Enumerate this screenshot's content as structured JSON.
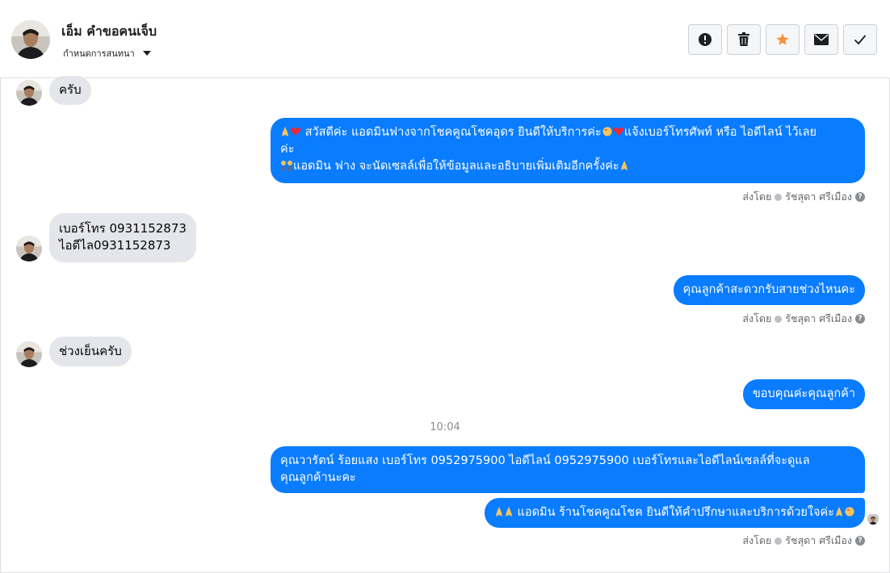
{
  "header": {
    "contact_name": "เอ็ม คำขอคนเจ็บ",
    "subtitle": "กำหนดการสนทนา",
    "actions": [
      {
        "name": "alert-button",
        "icon": "exclamation-circle-icon"
      },
      {
        "name": "delete-button",
        "icon": "trash-icon"
      },
      {
        "name": "star-button",
        "icon": "star-icon"
      },
      {
        "name": "mail-button",
        "icon": "envelope-icon"
      },
      {
        "name": "done-button",
        "icon": "check-icon"
      }
    ]
  },
  "messages": [
    {
      "from": "customer",
      "text": "ครับ"
    },
    {
      "from": "page",
      "line1": " สวัสดีค่ะ แอดมินฟางจากโชคคูณโชคอุดร ยินดีให้บริการค่ะ",
      "line1b": "แจ้งเบอร์โทรศัพท์ หรือ ไอดีไลน์  ไว้เลย",
      "line2": "ค่ะ",
      "line3": "แอดมิน ฟาง จะนัดเซลล์เพื่อให้ข้อมูลและอธิบายเพิ่มเติมอีกครั้งค่ะ"
    },
    {
      "from": "customer",
      "line1": "เบอร์โทร 0931152873",
      "line2": "ไอดีไล0931152873"
    },
    {
      "from": "page",
      "text": "คุณลูกค้าสะดวกรับสายช่วงไหนคะ"
    },
    {
      "from": "customer",
      "text": "ช่วงเย็นครับ"
    },
    {
      "from": "page",
      "text": "ขอบคุณค่ะคุณลูกค้า"
    },
    {
      "from": "page",
      "line1": "คุณวารัตน์ ร้อยแสง       เบอร์โทร 0952975900  ไอดีไลน์ 0952975900   เบอร์โทรและไอดีไลน์เซลล์ที่จะดูแล",
      "line2": "คุณลูกค้านะคะ"
    },
    {
      "from": "page",
      "text": " แอดมิน ร้านโชคคูณโชค ยินดีให้คำปรึกษาและบริการด้วยใจค่ะ"
    }
  ],
  "meta": {
    "sent_by": "ส่งโดย",
    "agent": "รัชสุดา ศรีเมือง"
  },
  "time_divider": "10:04",
  "colors": {
    "outgoing": "#0a7cff",
    "incoming": "#e4e6eb",
    "star": "#f7923a"
  }
}
